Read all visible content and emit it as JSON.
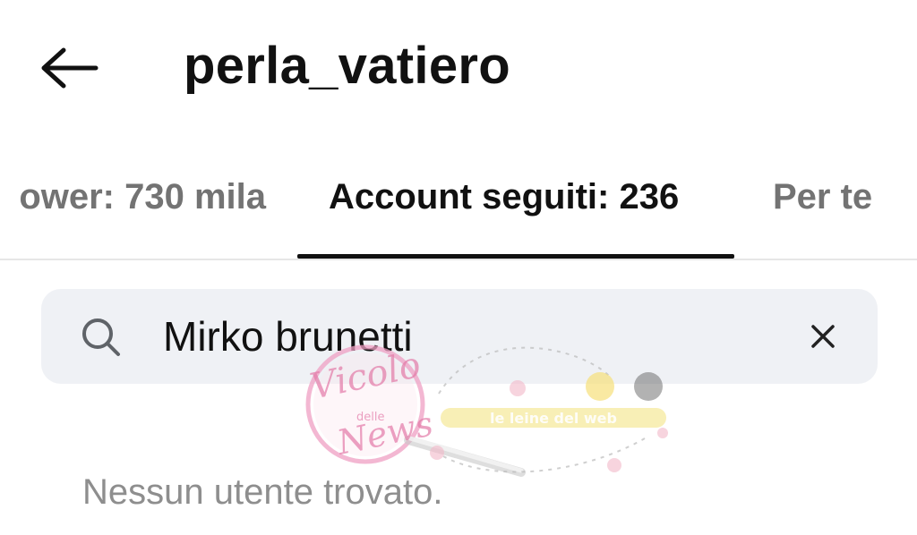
{
  "header": {
    "back_icon": "arrow-left-icon",
    "title": "perla_vatiero"
  },
  "tabs": [
    {
      "label": "ower: 730 mila",
      "active": false
    },
    {
      "label": "Account seguiti: 236",
      "active": true
    },
    {
      "label": "Per te",
      "active": false
    }
  ],
  "search": {
    "icon": "search-icon",
    "value": "Mirko brunetti",
    "clear_icon": "close-icon"
  },
  "results": {
    "empty_message": "Nessun utente trovato."
  },
  "watermark": {
    "logo_text": "Vicolo delle News",
    "secondary_text": "le leine del web"
  },
  "colors": {
    "text_primary": "#111111",
    "text_secondary": "#737373",
    "search_bg": "#eff1f5",
    "divider": "#e6e6e6",
    "watermark_pink": "#e9a3c0",
    "watermark_yellow": "#f3e27a"
  }
}
